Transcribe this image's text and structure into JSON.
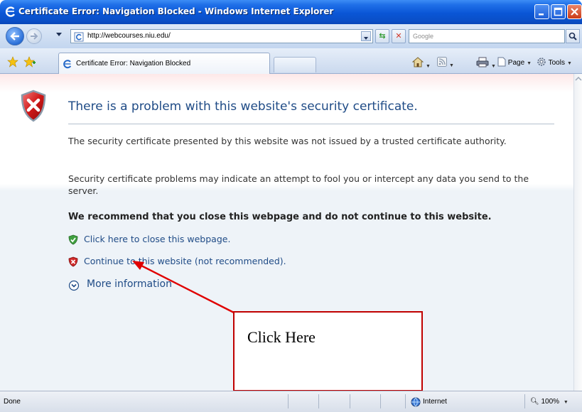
{
  "window": {
    "title": "Certificate Error: Navigation Blocked - Windows Internet Explorer"
  },
  "address_bar": {
    "url": "http://webcourses.niu.edu/",
    "search_placeholder": "Google"
  },
  "tabs": [
    {
      "label": "Certificate Error: Navigation Blocked",
      "active": true
    }
  ],
  "command_bar": {
    "page_label": "Page",
    "tools_label": "Tools"
  },
  "content": {
    "heading": "There is a problem with this website's security certificate.",
    "paragraph1": "The security certificate presented by this website was not issued by a trusted certificate authority.",
    "paragraph2": "Security certificate problems may indicate an attempt to fool you or intercept any data you send to the server.",
    "recommendation": "We recommend that you close this webpage and do not continue to this website.",
    "close_link": "Click here to close this webpage.",
    "continue_link": "Continue to this website (not recommended).",
    "more_info": "More information"
  },
  "annotation": {
    "label": "Click Here"
  },
  "status_bar": {
    "status": "Done",
    "zone": "Internet",
    "zoom": "100%"
  },
  "colors": {
    "heading": "#1f4b86",
    "link": "#1f4b86",
    "annotation": "#c00000",
    "titlebar": "#0a56d6"
  }
}
